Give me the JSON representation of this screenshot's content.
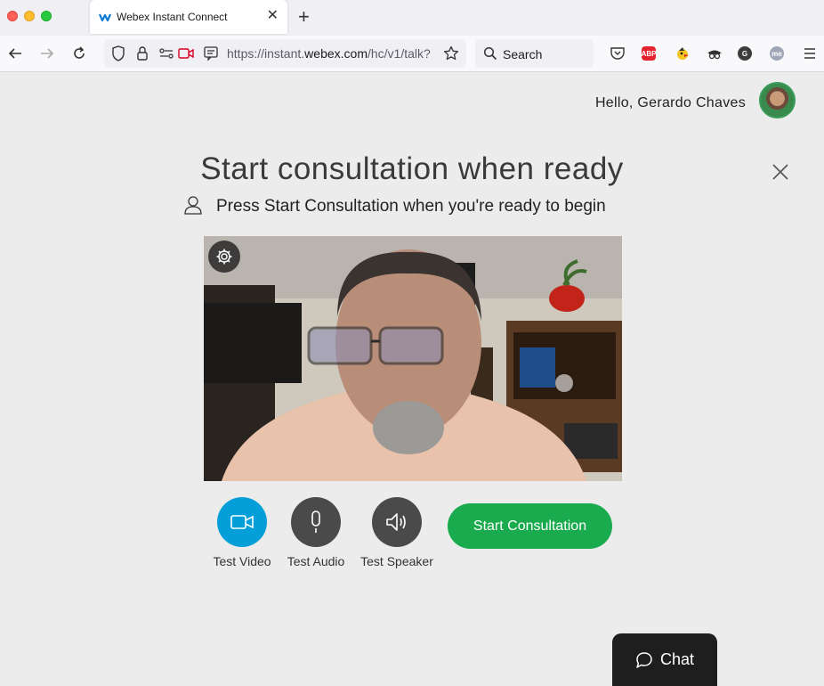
{
  "browser": {
    "tab_title": "Webex Instant Connect",
    "tab_close": "✕",
    "new_tab": "+",
    "url_prefix": "https://instant.",
    "url_host": "webex.com",
    "url_path": "/hc/v1/talk?",
    "search_label": "Search",
    "extensions": [
      {
        "name": "ABP",
        "color": "#e5232f"
      },
      {
        "name": "G",
        "color": "#3c3c3c"
      },
      {
        "name": "me",
        "color": "#9ea6b8"
      }
    ]
  },
  "header": {
    "greeting": "Hello, Gerardo Chaves"
  },
  "main": {
    "title": "Start consultation when ready",
    "subtitle": "Press Start Consultation when you're ready to begin"
  },
  "controls": {
    "test_video": "Test Video",
    "test_audio": "Test Audio",
    "test_speaker": "Test Speaker",
    "start_consultation": "Start Consultation",
    "video_color": "#049fd9",
    "neutral_color": "#4a4a4a"
  },
  "chat": {
    "label": "Chat"
  }
}
